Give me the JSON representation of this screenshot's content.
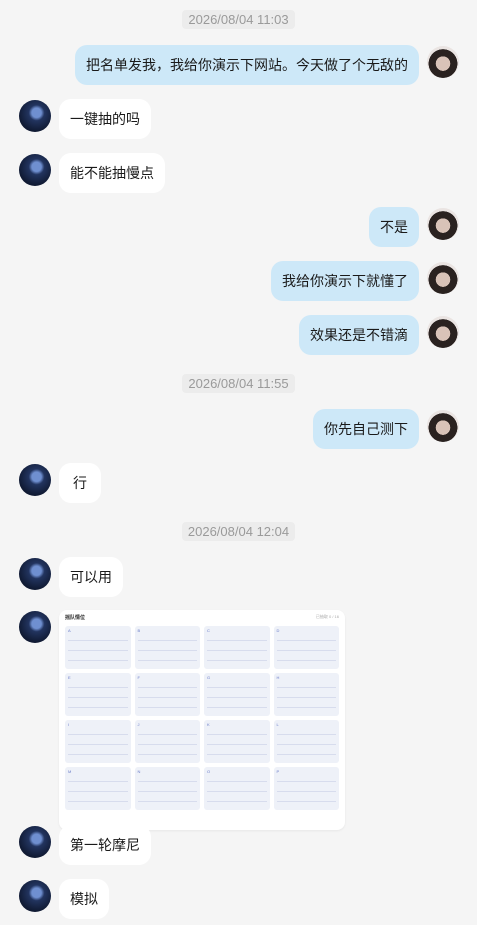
{
  "timestamps": [
    "2026/08/04 11:03",
    "2026/08/04 11:55",
    "2026/08/04 12:04"
  ],
  "messages": [
    {
      "side": "right",
      "text": "把名单发我，我给你演示下网站。今天做了个无敌的"
    },
    {
      "side": "left",
      "text": "一键抽的吗"
    },
    {
      "side": "left",
      "text": "能不能抽慢点"
    },
    {
      "side": "right",
      "text": "不是"
    },
    {
      "side": "right",
      "text": "我给你演示下就懂了"
    },
    {
      "side": "right",
      "text": "效果还是不错滴"
    },
    {
      "side": "right",
      "text": "你先自己测下"
    },
    {
      "side": "left",
      "text": "行"
    },
    {
      "side": "left",
      "text": "可以用"
    },
    {
      "side": "left",
      "text": "第一轮摩尼"
    },
    {
      "side": "left",
      "text": "模拟"
    }
  ],
  "image_card": {
    "title": "摇队情位",
    "meta": "已抽取 0 / 16",
    "groups": [
      "A",
      "B",
      "C",
      "D",
      "E",
      "F",
      "G",
      "H",
      "I",
      "J",
      "K",
      "L",
      "M",
      "N",
      "O",
      "P"
    ]
  },
  "colors": {
    "right_bubble": "#cde8f8",
    "left_bubble": "#ffffff",
    "background": "#f5f5f5"
  }
}
